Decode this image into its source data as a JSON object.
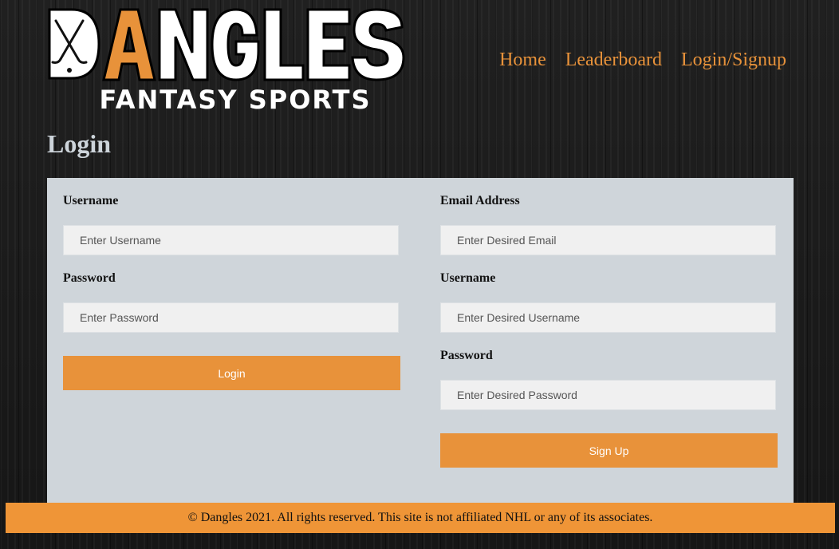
{
  "brand": {
    "name": "DANGLES",
    "tagline": "FANTASY SPORTS",
    "accent": "#e8923a",
    "logo_icon": "crossed-hockey-sticks-icon"
  },
  "nav": {
    "items": [
      {
        "label": "Home"
      },
      {
        "label": "Leaderboard"
      },
      {
        "label": "Login/Signup"
      }
    ]
  },
  "page": {
    "title": "Login"
  },
  "login": {
    "username_label": "Username",
    "username_placeholder": "Enter Username",
    "password_label": "Password",
    "password_placeholder": "Enter Password",
    "submit_label": "Login"
  },
  "signup": {
    "email_label": "Email Address",
    "email_placeholder": "Enter Desired Email",
    "username_label": "Username",
    "username_placeholder": "Enter Desired Username",
    "password_label": "Password",
    "password_placeholder": "Enter Desired Password",
    "submit_label": "Sign Up"
  },
  "footer": {
    "text": "© Dangles 2021. All rights reserved. This site is not affiliated NHL or any of its associates."
  },
  "colors": {
    "panel": "#cfd5da",
    "footer": "#ef9537",
    "input": "#f0f0f0"
  }
}
